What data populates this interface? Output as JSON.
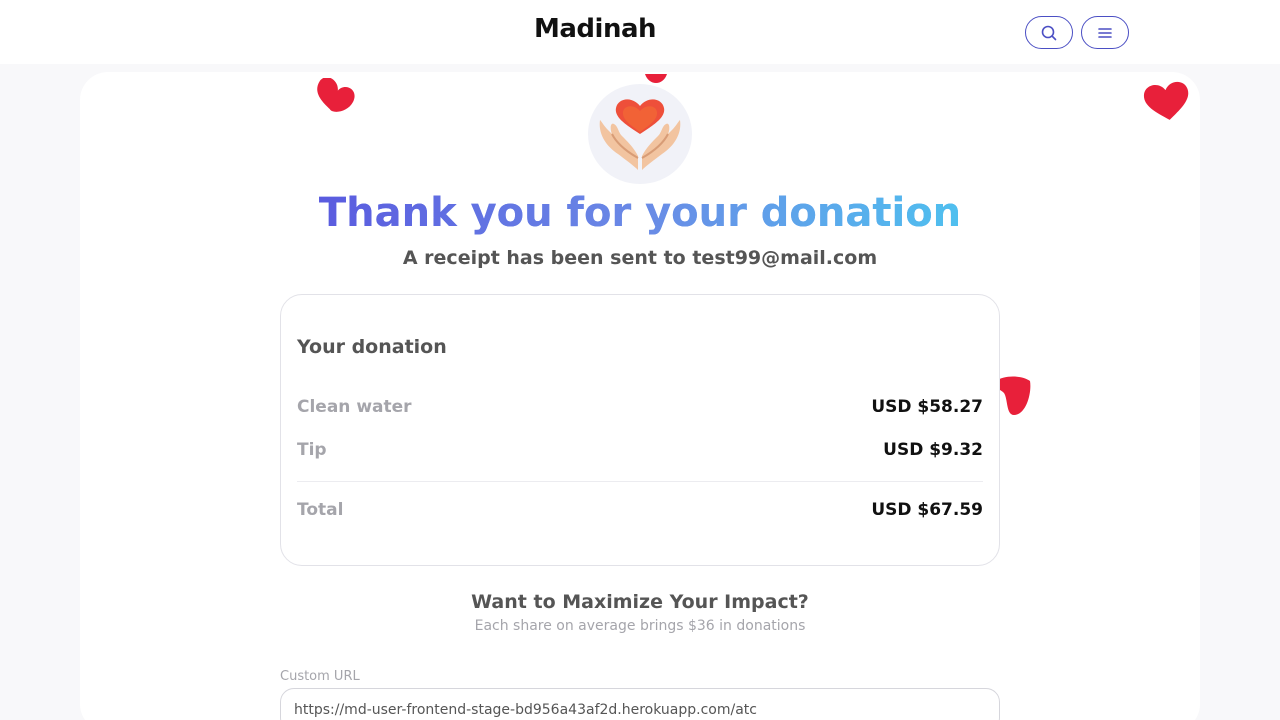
{
  "header": {
    "logo": "Madinah",
    "search_icon": "search-icon",
    "menu_icon": "menu-icon"
  },
  "hero": {
    "icon": "hands-holding-heart-icon",
    "title": "Thank you for your donation",
    "receipt_text": "A receipt has been sent to test99@mail.com"
  },
  "donation": {
    "title": "Your donation",
    "items": [
      {
        "label": "Clean water",
        "value": "USD $58.27"
      },
      {
        "label": "Tip",
        "value": "USD $9.32"
      }
    ],
    "total_label": "Total",
    "total_value": "USD $67.59"
  },
  "impact": {
    "title": "Want to Maximize Your Impact?",
    "subtitle": "Each share on average brings $36 in donations"
  },
  "share": {
    "url_label": "Custom URL",
    "url_value": "https://md-user-frontend-stage-bd956a43af2d.herokuapp.com/atc"
  },
  "colors": {
    "accent": "#4b4fc4",
    "heart": "#e8203a",
    "gradient_start": "#5a5bdf",
    "gradient_end": "#4fc0ef"
  }
}
